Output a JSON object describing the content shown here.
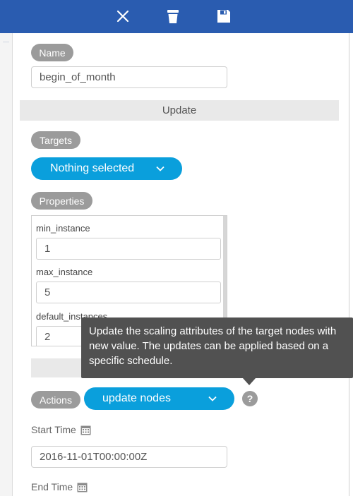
{
  "toolbar": {
    "close_icon": "close-icon",
    "delete_icon": "trash-icon",
    "save_icon": "save-icon",
    "bar_color": "#2a5cb0"
  },
  "form": {
    "name_label": "Name",
    "name_value": "begin_of_month",
    "section_title": "Update",
    "targets_label": "Targets",
    "targets_selected": "Nothing selected",
    "properties_label": "Properties",
    "properties": [
      {
        "label": "min_instance",
        "value": "1"
      },
      {
        "label": "max_instance",
        "value": "5"
      },
      {
        "label": "default_instances",
        "value": "2"
      }
    ],
    "actions_label": "Actions",
    "actions_selected": "update nodes",
    "tooltip_text": "Update the scaling attributes of the target nodes with new value. The updates can be applied based on a specific schedule.",
    "help_glyph": "?",
    "start_time_label": "Start Time",
    "start_time_value": "2016-11-01T00:00:00Z",
    "end_time_label": "End Time",
    "accent_color": "#0a9fdc"
  }
}
